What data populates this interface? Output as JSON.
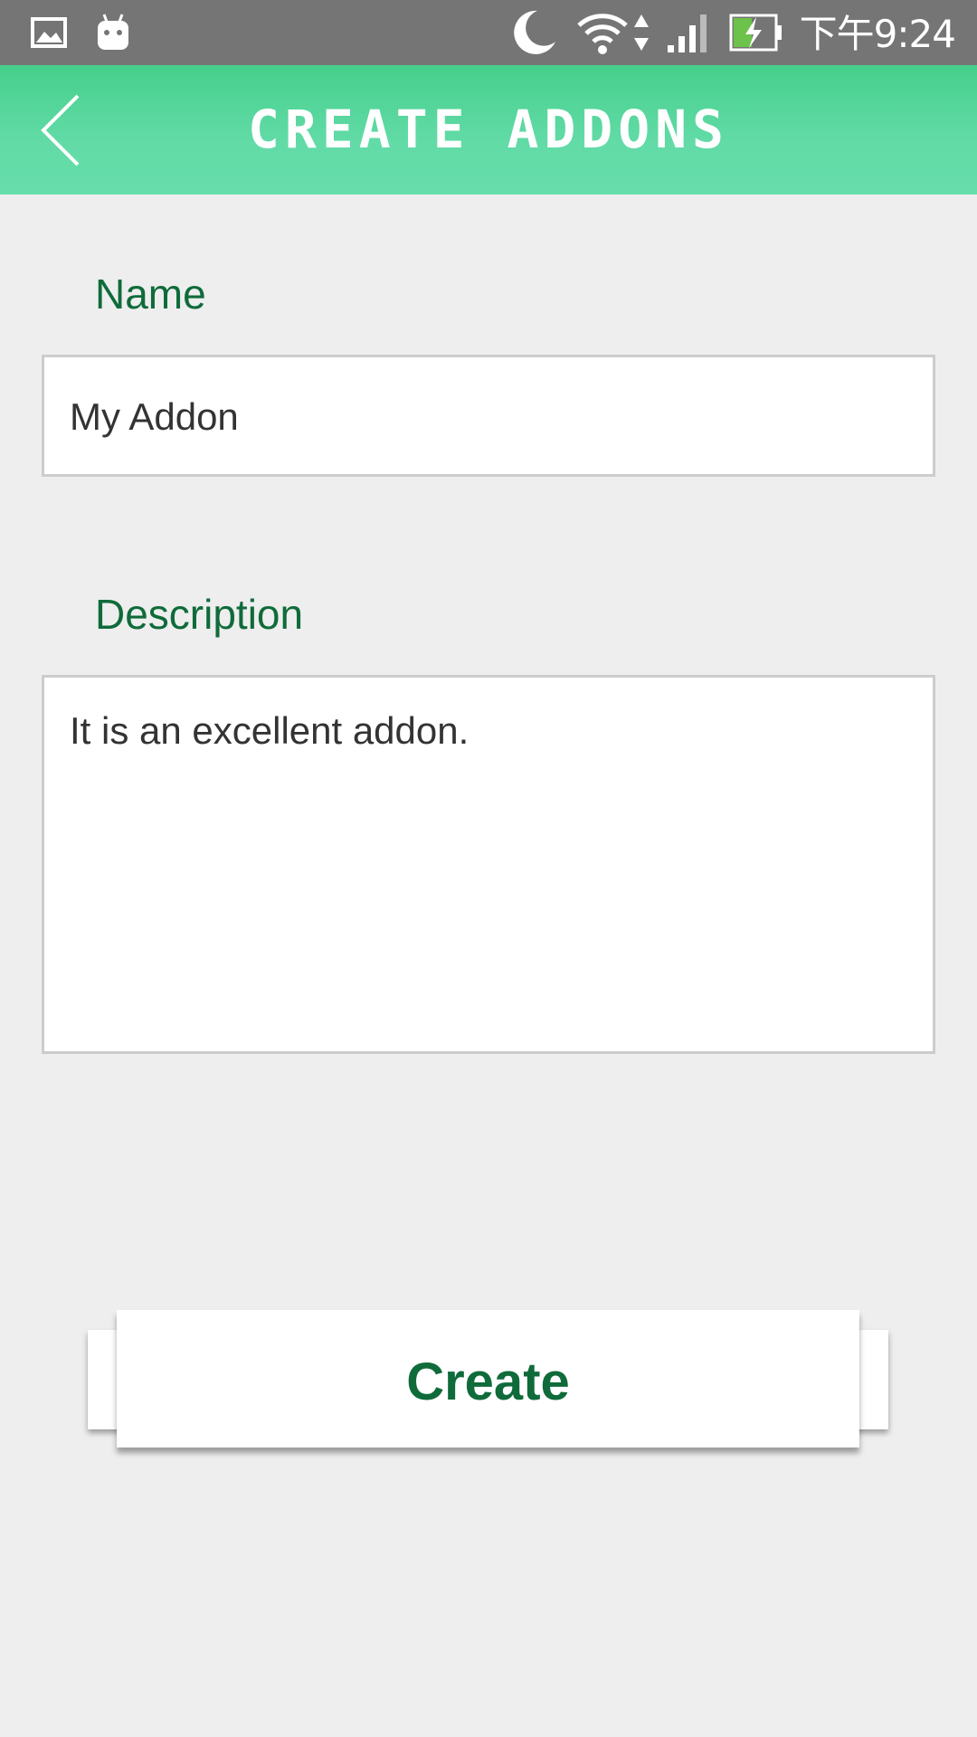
{
  "status_bar": {
    "time": "下午9:24",
    "icons": [
      "gallery-icon",
      "android-icon",
      "moon-icon",
      "wifi-icon",
      "data-arrows-icon",
      "signal-icon",
      "battery-charging-icon"
    ]
  },
  "app_bar": {
    "title": "CREATE ADDONS",
    "back_icon": "chevron-left-icon"
  },
  "form": {
    "name": {
      "label": "Name",
      "value": "My Addon"
    },
    "description": {
      "label": "Description",
      "value": "It is an excellent addon."
    }
  },
  "create_button": {
    "label": "Create"
  },
  "colors": {
    "accent": "#0f6b3a",
    "app_bar": "#5ed8a4",
    "status_bar": "#757575",
    "background": "#eeeeee"
  }
}
